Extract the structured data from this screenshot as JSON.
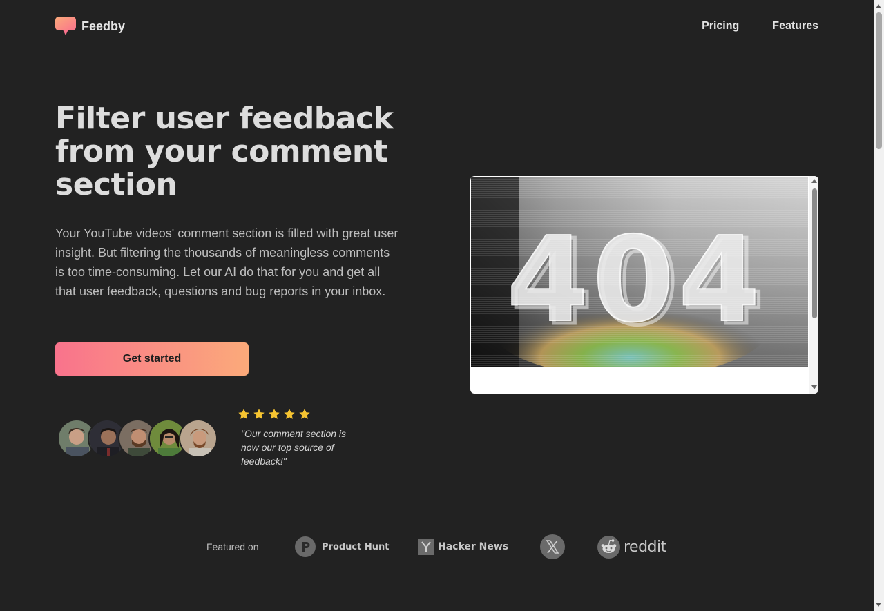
{
  "brand": {
    "name": "Feedby"
  },
  "nav": {
    "items": [
      {
        "label": "Pricing"
      },
      {
        "label": "Features"
      }
    ]
  },
  "hero": {
    "title": "Filter user feedback from your comment section",
    "description": "Your YouTube videos' comment section is filled with great user insight. But filtering the thousands of meaningless comments is too time-consuming. Let our AI do that for you and get all that user feedback, questions and bug reports in your inbox.",
    "cta_label": "Get started"
  },
  "social_proof": {
    "rating": 5,
    "quote": "\"Our comment section is now our top source of feedback!\""
  },
  "embed": {
    "error_text": "404"
  },
  "featured": {
    "label": "Featured on",
    "sites": [
      {
        "name": "Product Hunt",
        "icon": "product-hunt-icon"
      },
      {
        "name": "Hacker News",
        "icon": "hacker-news-icon"
      },
      {
        "name": "X",
        "icon": "x-icon"
      },
      {
        "name": "reddit",
        "icon": "reddit-icon"
      }
    ]
  },
  "colors": {
    "background": "#222222",
    "cta_gradient_start": "#f9738c",
    "cta_gradient_end": "#fbaa7a",
    "star": "#f6c431"
  }
}
